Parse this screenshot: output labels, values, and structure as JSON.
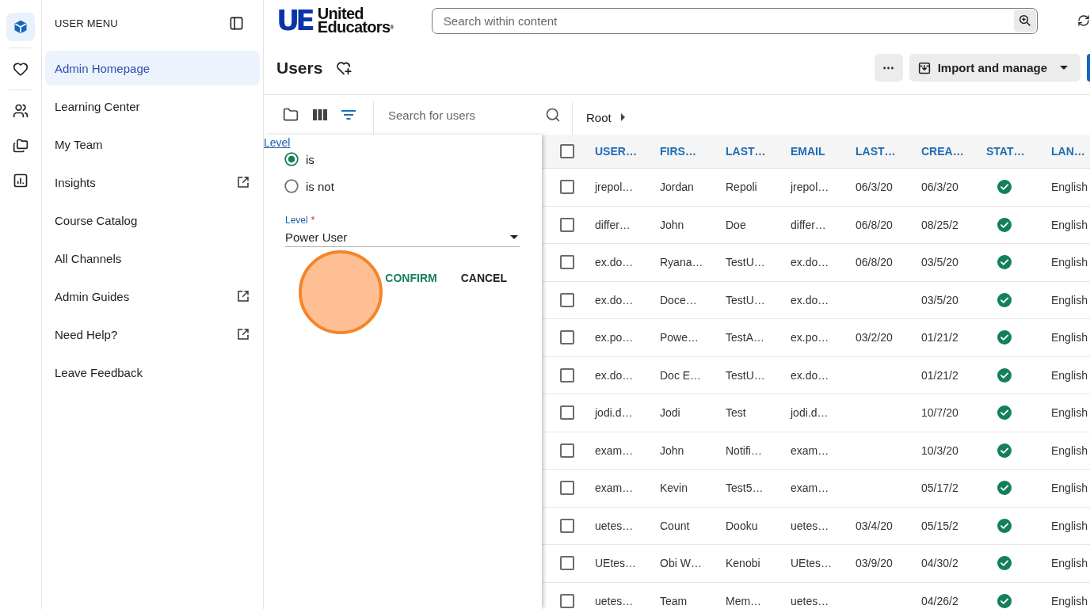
{
  "icon_rail": [
    [
      {
        "kind": "cube",
        "selected": true
      }
    ],
    [
      {
        "kind": "heart",
        "selected": false
      }
    ],
    [
      {
        "kind": "people",
        "selected": false
      },
      {
        "kind": "folders",
        "selected": false
      },
      {
        "kind": "chart",
        "selected": false
      }
    ]
  ],
  "user_menu": {
    "title": "USER MENU",
    "items": [
      {
        "label": "Admin Homepage",
        "selected": true,
        "external": false
      },
      {
        "label": "Learning Center",
        "selected": false,
        "external": false
      },
      {
        "label": "My Team",
        "selected": false,
        "external": false
      },
      {
        "label": "Insights",
        "selected": false,
        "external": true
      },
      {
        "label": "Course Catalog",
        "selected": false,
        "external": false
      },
      {
        "label": "All Channels",
        "selected": false,
        "external": false
      },
      {
        "label": "Admin Guides",
        "selected": false,
        "external": true
      },
      {
        "label": "Need Help?",
        "selected": false,
        "external": true
      },
      {
        "label": "Leave Feedback",
        "selected": false,
        "external": false
      }
    ]
  },
  "header": {
    "logo": {
      "mark": "UE",
      "lines": [
        "United",
        "Educators$^{®}$"
      ]
    },
    "search": {
      "placeholder": "Search within content"
    }
  },
  "page": {
    "title": "Users",
    "actions": [
      {
        "kind": "more"
      },
      {
        "kind": "menu",
        "label": "Import and manage"
      },
      {
        "kind": "primary"
      }
    ]
  },
  "toolbar": {
    "views": [
      {
        "kind": "folder",
        "selected": false
      },
      {
        "kind": "columns",
        "selected": false
      },
      {
        "kind": "filter",
        "selected": true
      }
    ],
    "search": {
      "placeholder": "Search for users"
    },
    "breadcrumb": [
      "Root"
    ]
  },
  "filter_panel": {
    "field": "Level",
    "options": [
      {
        "label": "is",
        "selected": true
      },
      {
        "label": "is not",
        "selected": false
      }
    ],
    "select": {
      "label": "Level",
      "required_mark": "*",
      "value": "Power User"
    },
    "actions": [
      {
        "kind": "primary",
        "label": "CONFIRM"
      },
      {
        "kind": "secondary",
        "label": "CANCEL"
      }
    ]
  },
  "click_marker": {
    "shown": true
  },
  "table": {
    "select_all": {
      "checked": false
    },
    "columns": [
      {
        "label": "USER…",
        "kind": "text"
      },
      {
        "label": "FIRS…",
        "kind": "text"
      },
      {
        "label": "LAST…",
        "kind": "text"
      },
      {
        "label": "EMAIL",
        "kind": "text"
      },
      {
        "label": "LAST…",
        "kind": "text"
      },
      {
        "label": "CREA…",
        "kind": "text"
      },
      {
        "label": "STAT…",
        "kind": "status"
      },
      {
        "label": "LAN…",
        "kind": "text"
      }
    ],
    "rows": [
      {
        "checked": false,
        "active": true,
        "cells": [
          "jrepol…",
          "Jordan",
          "Repoli",
          "jrepol…",
          "06/3/20",
          "06/3/20",
          null,
          "English"
        ]
      },
      {
        "checked": false,
        "active": true,
        "cells": [
          "differ…",
          "John",
          "Doe",
          "differ…",
          "06/8/20",
          "08/25/2",
          null,
          "English"
        ]
      },
      {
        "checked": false,
        "active": true,
        "cells": [
          "ex.do…",
          "Ryana…",
          "TestU…",
          "ex.do…",
          "06/8/20",
          "03/5/20",
          null,
          "English"
        ]
      },
      {
        "checked": false,
        "active": true,
        "cells": [
          "ex.do…",
          "Doce…",
          "TestU…",
          "ex.do…",
          null,
          "03/5/20",
          null,
          "English"
        ]
      },
      {
        "checked": false,
        "active": true,
        "cells": [
          "ex.po…",
          "Powe…",
          "TestA…",
          "ex.po…",
          "03/2/20",
          "01/21/2",
          null,
          "English"
        ]
      },
      {
        "checked": false,
        "active": true,
        "cells": [
          "ex.do…",
          "Doc E…",
          "TestU…",
          "ex.do…",
          null,
          "01/21/2",
          null,
          "English"
        ]
      },
      {
        "checked": false,
        "active": true,
        "cells": [
          "jodi.d…",
          "Jodi",
          "Test",
          "jodi.d…",
          null,
          "10/7/20",
          null,
          "English"
        ]
      },
      {
        "checked": false,
        "active": true,
        "cells": [
          "exam…",
          "John",
          "Notifi…",
          "exam…",
          null,
          "10/3/20",
          null,
          "English"
        ]
      },
      {
        "checked": false,
        "active": true,
        "cells": [
          "exam…",
          "Kevin",
          "Test5…",
          "exam…",
          null,
          "05/17/2",
          null,
          "English"
        ]
      },
      {
        "checked": false,
        "active": true,
        "cells": [
          "uetes…",
          "Count",
          "Dooku",
          "uetes…",
          "03/4/20",
          "05/15/2",
          null,
          "English"
        ]
      },
      {
        "checked": false,
        "active": true,
        "cells": [
          "UEtes…",
          "Obi W…",
          "Kenobi",
          "UEtes…",
          "03/9/20",
          "04/30/2",
          null,
          "English"
        ]
      },
      {
        "checked": false,
        "active": true,
        "cells": [
          "uetes…",
          "Team",
          "Mem…",
          "uetes…",
          null,
          "04/26/2",
          null,
          "English"
        ]
      }
    ]
  }
}
